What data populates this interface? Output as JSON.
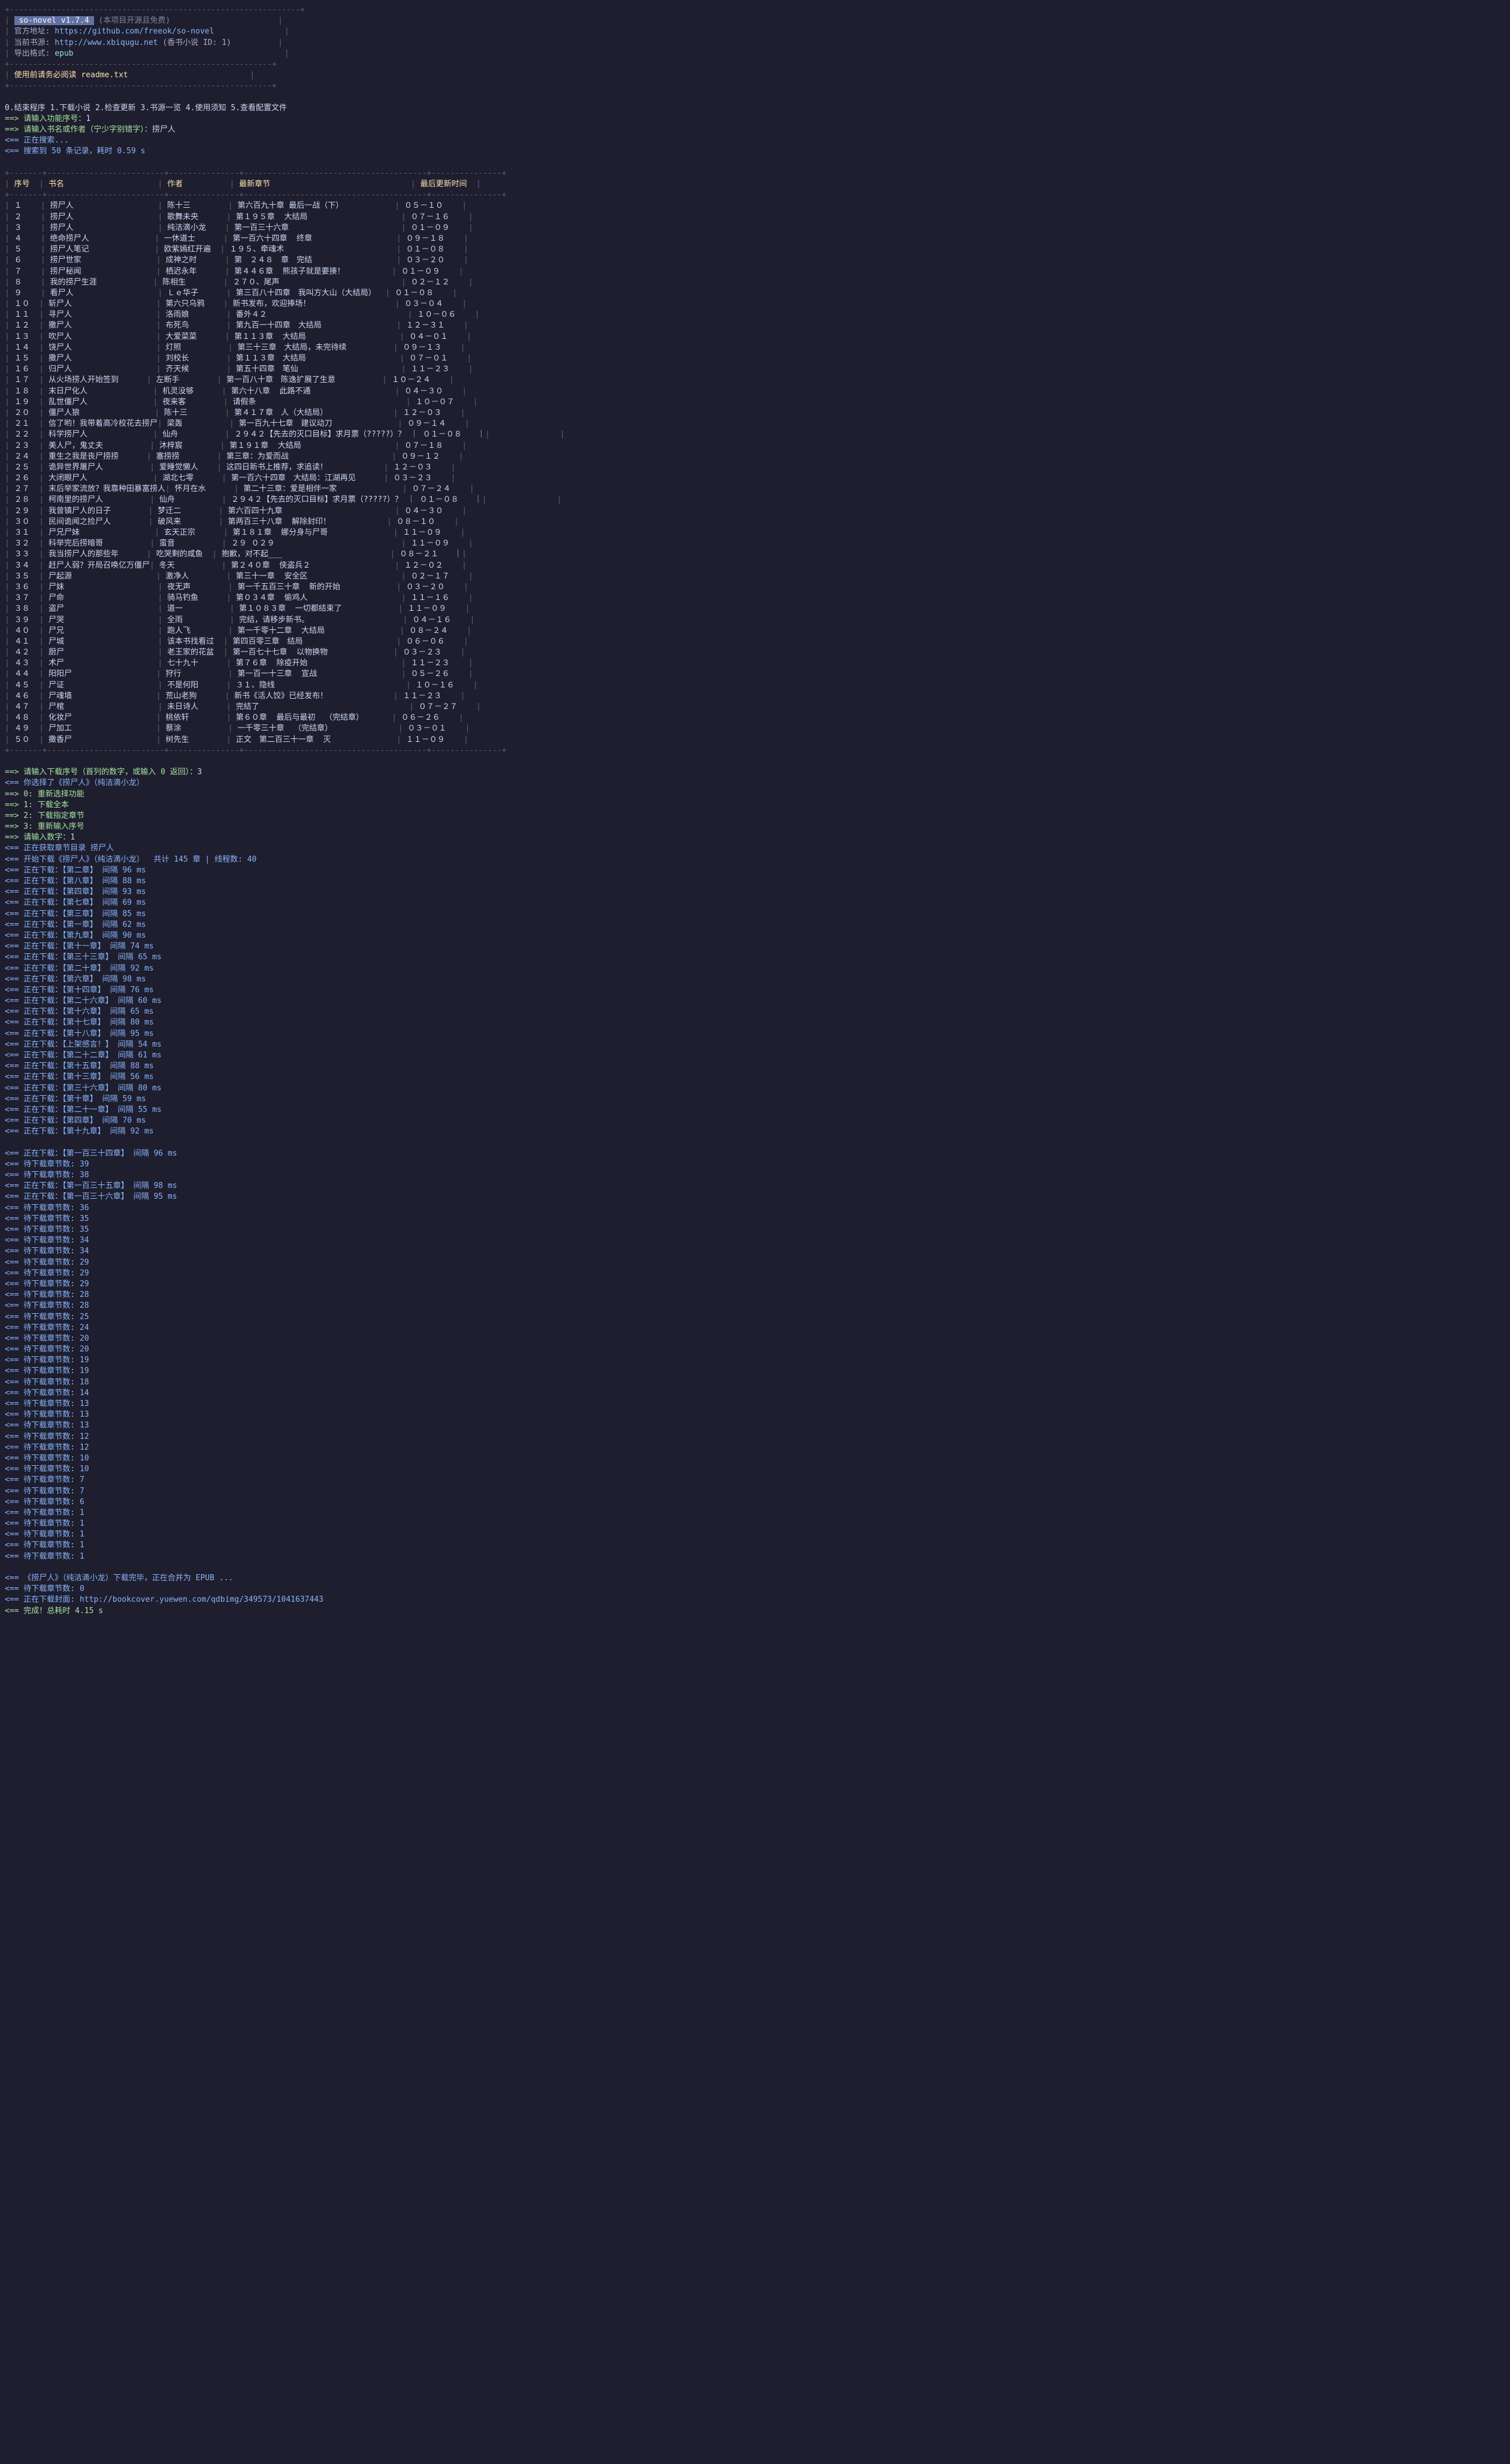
{
  "banner": {
    "app": "so-novel v1.7.4",
    "note": "(本项目开源且免费)",
    "lines": [
      {
        "label": "官方地址: ",
        "url": "https://github.com/freeok/so-novel"
      },
      {
        "label": "当前书源: ",
        "url": "http://www.xbiqugu.net",
        "suffix": " (香书小说 ID: 1)"
      },
      {
        "label": "导出格式: ",
        "value": "epub"
      }
    ],
    "warn": "使用前请务必阅读 readme.txt"
  },
  "menu": "0.结束程序 1.下载小说 2.检查更新 3.书源一览 4.使用须知 5.查看配置文件",
  "prompts": {
    "p_func": "==> 请输入功能序号：",
    "v_func": "1",
    "p_kw": "==> 请输入书名或作者（宁少字别错字）：",
    "v_kw": "捞尸人",
    "searching": "<== 正在搜索...",
    "result": "<== 搜索到 50 条记录，耗时 0.59 s"
  },
  "table": {
    "headers": [
      "序号",
      "书名",
      "作者",
      "最新章节",
      "最后更新时间"
    ],
    "rows": [
      [
        "１",
        "捞尸人",
        "陈十三",
        "第六百九十章 最后一战（下）",
        "０５－１０"
      ],
      [
        "２",
        "捞尸人",
        "歌舞未央",
        "第１９５章  大结局",
        "０７－１６"
      ],
      [
        "３",
        "捞尸人",
        "纯洁滴小龙",
        "第一百三十六章",
        "０１－０９"
      ],
      [
        "４",
        "绝命捞尸人",
        "一休道士",
        "第一百六十四章  终章",
        "０９－１８"
      ],
      [
        "５",
        "捞尸人笔记",
        "欧紫嫣红开遍",
        "１９５、牵魂术",
        "０１－０８"
      ],
      [
        "６",
        "捞尸世家",
        "成神之时",
        "第　２４８　章　完结",
        "０３－２０"
      ],
      [
        "７",
        "捞尸秘闻",
        "栖迟永年",
        "第４４６章  熊孩子就是要揍！",
        "０１－０９"
      ],
      [
        "８",
        "我的捞尸生涯",
        "陈相生",
        "２７０、尾声",
        "０２－１２"
      ],
      [
        "９",
        "看尸人",
        "Ｌｅ华子",
        "第三百八十四章　我叫方大山（大结局）",
        "０１－０８"
      ],
      [
        "１０",
        "斩尸人",
        "第六只乌鸦",
        "新书发布，欢迎捧场！",
        "０３－０４"
      ],
      [
        "１１",
        "寻尸人",
        "洛雨娘",
        "番外４２",
        "１０－０６"
      ],
      [
        "１２",
        "撒尸人",
        "布死鸟",
        "第九百一十四章　大结局",
        "１２－３１"
      ],
      [
        "１３",
        "吹尸人",
        "大爱菜菜",
        "第１１３章  大结局",
        "０４－０１"
      ],
      [
        "１４",
        "饶尸人",
        "灯照",
        "第三十三章　大结局，未完待续",
        "０９－１３"
      ],
      [
        "１５",
        "撒尸人",
        "刘校长",
        "第１１３章　大结局",
        "０７－０１"
      ],
      [
        "１６",
        "归尸人",
        "齐天候",
        "第五十四章　笔仙",
        "１１－２３"
      ],
      [
        "１７",
        "从火场捞人开始签到",
        "左断手",
        "第一百八十章　陈逸扩展了生意",
        "１０－２４"
      ],
      [
        "１８",
        "末日尸化人",
        "机灵没够",
        "第六十八章  此路不通",
        "０４－３０"
      ],
      [
        "１９",
        "乱世僵尸人",
        "夜来客",
        "请假条",
        "１０－０７"
      ],
      [
        "２０",
        "僵尸人狼",
        "陈十三",
        "第４１７章　人（大结局）",
        "１２－０３"
      ],
      [
        "２１",
        "信了哟！我带着高冷校花去捞尸",
        "梁轰",
        "第一百九十七章　建议动刀",
        "０９－１４"
      ],
      [
        "２２",
        "科学捞尸人",
        "仙舟",
        "２９４２【先去的灭口目标】求月票（?????）？ ｜ ０１－０８　　｜",
        ""
      ],
      [
        "２３",
        "美人尸，鬼丈夫",
        "沐梓宸",
        "第１９１章  大结局",
        "０７－１８"
      ],
      [
        "２４",
        "重生之我是丧尸捞捞",
        "塞捞捞",
        "第三章：为爱而战",
        "０９－１２"
      ],
      [
        "２５",
        "诡异世界屠尸人",
        "爱睡觉懒人",
        "这四日新书上推荐，求追读！",
        "１２－０３"
      ],
      [
        "２６",
        "大闭眼尸人",
        "湖北七零",
        "第一百六十四章　大结局：江湖再见",
        "０３－２３"
      ],
      [
        "２７",
        "末后举家流放？我靠种田暴富捞人",
        "怀月在水",
        "第二十三章：爱是相伴一家",
        "０７－２４"
      ],
      [
        "２８",
        "柯南里的捞尸人",
        "仙舟",
        "２９４２【先去的灭口目标】求月票（?????）？ ｜ ０１－０８　　｜",
        ""
      ],
      [
        "２９",
        "我曾镇尸人的日子",
        "梦迁二",
        "第六百四十九章",
        "０４－３０"
      ],
      [
        "３０",
        "民间诡闻之捡尸人",
        "破风来",
        "第两百三十八章  解除封印！",
        "０８－１０"
      ],
      [
        "３１",
        "尸兄尸妹",
        "玄天正宗",
        "第１８１章  娜分身与尸哥",
        "１１－０９"
      ],
      [
        "３２",
        "科举完后捞暗哥",
        "蛮音",
        "２９ ０２９",
        "１１－０９"
      ],
      [
        "３３",
        "我当捞尸人的那些年",
        "吃哭剩的咸鱼",
        "抱歉，对不起___",
        "０８－２１　　｜"
      ],
      [
        "３４",
        "赶尸人弱？开局召唤亿万僵尸",
        "冬天",
        "第２４０章  侠盗兵２",
        "１２－０２"
      ],
      [
        "３５",
        "尸起源",
        "激净人",
        "第三十一章  安全区",
        "０２－１７"
      ],
      [
        "３６",
        "尸妹",
        "夜无声",
        "第一千五百三十章  新的开始",
        "０３－２０"
      ],
      [
        "３７",
        "尸命",
        "骑马钓鱼",
        "第０３４章  偷鸡人",
        "１１－１６"
      ],
      [
        "３８",
        "盗尸",
        "道一",
        "第１０８３章  一切都结束了",
        "１１－０９"
      ],
      [
        "３９",
        "尸哭",
        "全雨",
        "完结，请移步新书。",
        "０４－１６"
      ],
      [
        "４０",
        "尸兄",
        "跑人飞",
        "第一千零十二章  大结局",
        "０８－２４"
      ],
      [
        "４１",
        "尸城",
        "该本书找看过",
        "第四百零三章　结局",
        "０６－０６"
      ],
      [
        "４２",
        "厨尸",
        "老王家的花盆",
        "第一百七十七章  以物换物",
        "０３－２３"
      ],
      [
        "４３",
        "术尸",
        "七十九十",
        "第７６章  除疫开始",
        "１１－２３"
      ],
      [
        "４４",
        "阳阳尸",
        "狩行",
        "第一百一十三章  宣战",
        "０５－２６"
      ],
      [
        "４５",
        "尸证",
        "不是何阳",
        "３１、隐线",
        "１０－１６"
      ],
      [
        "４６",
        "尸魂墙",
        "荒山老狗",
        "新书《活人饺》已经发布！",
        "１１－２３"
      ],
      [
        "４７",
        "尸棺",
        "未日诗人",
        "完结了",
        "０７－２７"
      ],
      [
        "４８",
        "化妆尸",
        "桃依轩",
        "第６０章  最后与最初  （完结章）",
        "０６－２６"
      ],
      [
        "４９",
        "尸加工",
        "蔡涂",
        "一千零三十章  （完结章）",
        "０３－０１"
      ],
      [
        "５０",
        "撒香尸",
        "树先生",
        "正文　第二百三十一章  灭",
        "１１－０９"
      ]
    ]
  },
  "after": {
    "p_dl": "==> 请输入下载序号（首列的数字，或输入 0 返回）：",
    "v_dl": "3",
    "chosen": "<== 你选择了《捞尸人》（纯洁滴小龙）",
    "opts": [
      "==> 0: 重新选择功能",
      "==> 1: 下载全本",
      "==> 2: 下载指定章节",
      "==> 3: 重新输入序号"
    ],
    "p_num": "==> 请输入数字：",
    "v_num": "1",
    "fetching": "<== 正在获取章节目录 捞尸人",
    "start": "<== 开始下载《捞尸人》（纯洁滴小龙）  共计 145 章 | 线程数: 40"
  },
  "downloads": [
    "<== 正在下载：【第二章】 间隔 96 ms",
    "<== 正在下载：【第八章】 间隔 88 ms",
    "<== 正在下载：【第四章】 间隔 93 ms",
    "<== 正在下载：【第七章】 间隔 69 ms",
    "<== 正在下载：【第三章】 间隔 85 ms",
    "<== 正在下载：【第一章】 间隔 62 ms",
    "<== 正在下载：【第九章】 间隔 90 ms",
    "<== 正在下载：【第十一章】 间隔 74 ms",
    "<== 正在下载：【第三十三章】 间隔 65 ms",
    "<== 正在下载：【第二十章】 间隔 92 ms",
    "<== 正在下载：【第六章】 间隔 98 ms",
    "<== 正在下载：【第十四章】 间隔 76 ms",
    "<== 正在下载：【第二十六章】 间隔 60 ms",
    "<== 正在下载：【第十六章】 间隔 65 ms",
    "<== 正在下载：【第十七章】 间隔 80 ms",
    "<== 正在下载：【第十八章】 间隔 95 ms",
    "<== 正在下载：【上架感言！】 间隔 54 ms",
    "<== 正在下载：【第二十二章】 间隔 61 ms",
    "<== 正在下载：【第十五章】 间隔 88 ms",
    "<== 正在下载：【第十三章】 间隔 56 ms",
    "<== 正在下载：【第三十六章】 间隔 80 ms",
    "<== 正在下载：【第十章】 间隔 59 ms",
    "<== 正在下载：【第二十一章】 间隔 55 ms",
    "<== 正在下载：【第四章】 间隔 70 ms",
    "<== 正在下载：【第十九章】 间隔 92 ms"
  ],
  "wait1": [
    "<== 正在下载：【第一百三十四章】 间隔 96 ms",
    "<== 待下载章节数: 39",
    "<== 待下载章节数: 38",
    "<== 正在下载：【第一百三十五章】 间隔 98 ms",
    "<== 正在下载：【第一百三十六章】 间隔 95 ms",
    "<== 待下载章节数: 36"
  ],
  "wait2": [
    35,
    35,
    34,
    34,
    29,
    29,
    29,
    28,
    28,
    25,
    24,
    20,
    20,
    19,
    19,
    18,
    14,
    13,
    13,
    13,
    12,
    12,
    10,
    10,
    7,
    7,
    6,
    1,
    1,
    1,
    1,
    1
  ],
  "finish": {
    "done_dl": "<== 《捞尸人》（纯洁滴小龙）下载完毕，正在合并为 EPUB ...",
    "zero": "<== 待下载章节数: 0",
    "cover": "<== 正在下载封面: http://bookcover.yuewen.com/qdbimg/349573/1041637443",
    "done": "<== 完成！总耗时 4.15 s"
  }
}
